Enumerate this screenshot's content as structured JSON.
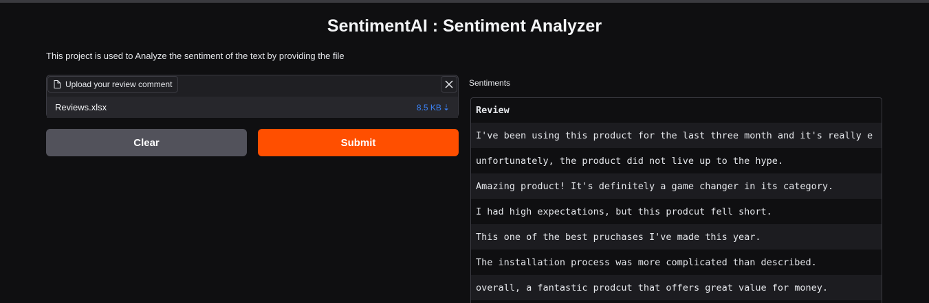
{
  "header": {
    "title": "SentimentAI : Sentiment Analyzer",
    "description": "This project is used to Analyze the sentiment of the text by providing the file"
  },
  "upload": {
    "label": "Upload your review comment",
    "file_name": "Reviews.xlsx",
    "file_size": "8.5 KB",
    "download_glyph": "⇣"
  },
  "buttons": {
    "clear": "Clear",
    "submit": "Submit"
  },
  "output": {
    "label": "Sentiments",
    "column_header": "Review",
    "rows": [
      "I've been using this product for the last three month and it's really e",
      "unfortunately, the product did not live up to the hype.",
      "Amazing product! It's definitely a game changer in its category.",
      "I had high expectations, but this prodcut fell short.",
      "This one of the best pruchases I've made this year.",
      "The installation process was more complicated than described.",
      "overall, a fantastic prodcut that offers great value for money."
    ]
  },
  "colors": {
    "submit": "#ff4f00",
    "clear": "#52525b",
    "link": "#3b82f6",
    "background": "#0f0f11"
  }
}
